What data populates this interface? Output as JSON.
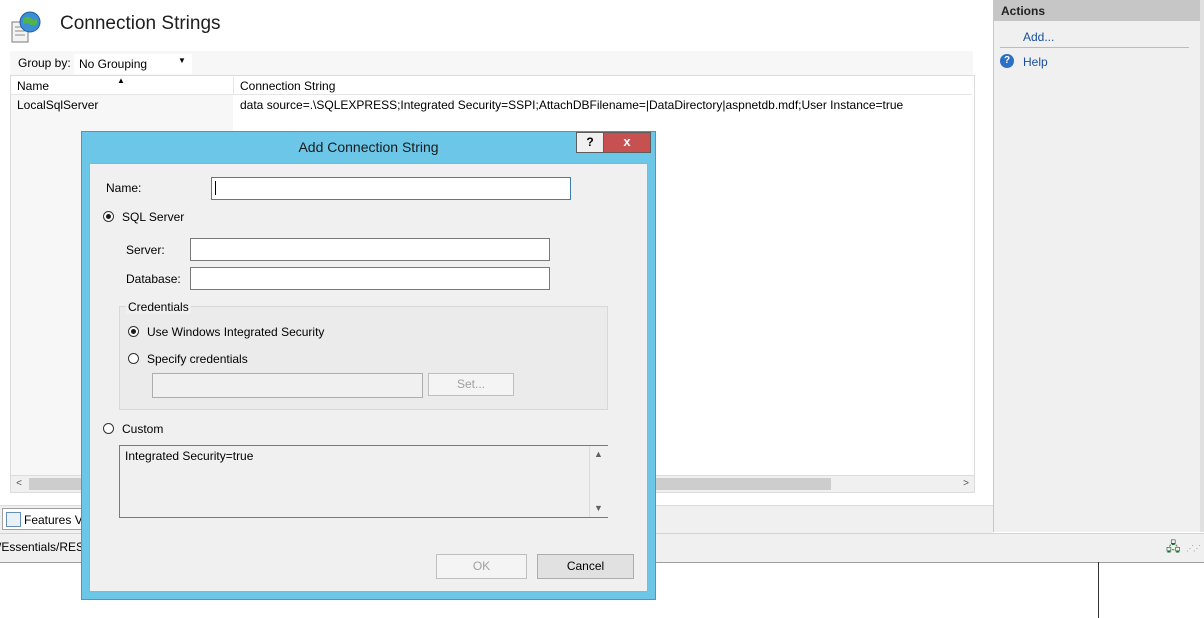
{
  "page": {
    "title": "Connection Strings",
    "group_by_label": "Group by:",
    "group_by_value": "No Grouping",
    "columns": [
      "Name",
      "Connection String"
    ],
    "rows": [
      {
        "name": "LocalSqlServer",
        "connection_string": "data source=.\\SQLEXPRESS;Integrated Security=SSPI;AttachDBFilename=|DataDirectory|aspnetdb.mdf;User Instance=true"
      }
    ],
    "features_tab_label": "Features Vi",
    "status_path": "/Essentials/RES"
  },
  "actions": {
    "title": "Actions",
    "add_label": "Add...",
    "help_label": "Help"
  },
  "dialog": {
    "title": "Add Connection String",
    "help_button": "?",
    "close_button": "x",
    "name_label": "Name:",
    "name_value": "",
    "sql_server_label": "SQL Server",
    "sql_server_selected": true,
    "server_label": "Server:",
    "server_value": "",
    "database_label": "Database:",
    "database_value": "",
    "credentials_title": "Credentials",
    "windows_security_label": "Use Windows Integrated Security",
    "windows_security_selected": true,
    "specify_credentials_label": "Specify credentials",
    "credentials_value": "",
    "set_button": "Set...",
    "custom_label": "Custom",
    "custom_value": "Integrated Security=true",
    "ok_button": "OK",
    "cancel_button": "Cancel"
  },
  "colors": {
    "dialog_frame": "#6bc6e8",
    "close_button": "#c75050",
    "link": "#1a4f9c"
  }
}
